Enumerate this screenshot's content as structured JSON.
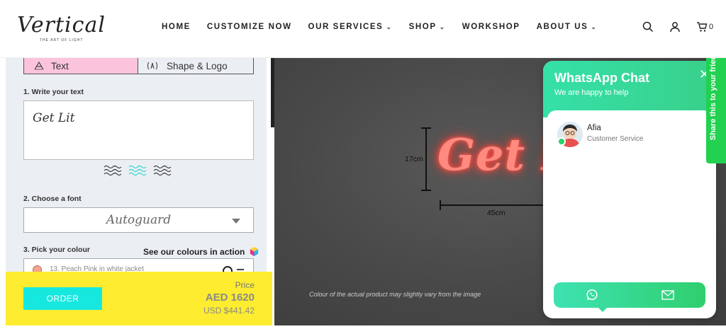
{
  "brand": {
    "logo": "Vertical",
    "tagline": "THE ART OF LIGHT"
  },
  "nav": {
    "items": [
      {
        "label": "HOME",
        "dropdown": false
      },
      {
        "label": "CUSTOMIZE NOW",
        "dropdown": false
      },
      {
        "label": "OUR SERVICES",
        "dropdown": true
      },
      {
        "label": "SHOP",
        "dropdown": true
      },
      {
        "label": "WORKSHOP",
        "dropdown": false
      },
      {
        "label": "ABOUT US",
        "dropdown": true
      }
    ],
    "icons": [
      "search-icon",
      "user-icon",
      "cart-icon"
    ],
    "cart_count": "0"
  },
  "builder": {
    "tabs": [
      {
        "label": "Text",
        "active": true,
        "icon": "text-style-icon"
      },
      {
        "label": "Shape & Logo",
        "active": false,
        "icon": "logo-shape-icon"
      }
    ],
    "step1_label": "1. Write your text",
    "text_value": "Get Lit",
    "step2_label": "2. Choose a font",
    "font_value": "Autoguard",
    "step3_label": "3. Pick your colour",
    "colours_link": "See our colours in action",
    "colour_value": "13. Peach Pink in white jacket",
    "order_button": "ORDER",
    "price_label": "Price",
    "price_aed": "AED 1620",
    "price_usd": "USD $441.42"
  },
  "preview": {
    "neon_text": "Get Lit",
    "height_label": "17cm",
    "width_label": "45cm",
    "disclaimer": "Colour of the actual product may slightly vary from the image"
  },
  "whatsapp": {
    "title": "WhatsApp Chat",
    "subtitle": "We are happy to help",
    "agent_name": "Afia",
    "agent_role": "Customer Service"
  },
  "share_tab": {
    "label": "Share this to your friends"
  },
  "colors": {
    "accent_cyan": "#16e8e0",
    "order_bar_yellow": "#fdec2f",
    "tab_pink": "#fcc4dc",
    "whatsapp_green": "#25d366",
    "neon_glow": "#ff5a4f"
  }
}
